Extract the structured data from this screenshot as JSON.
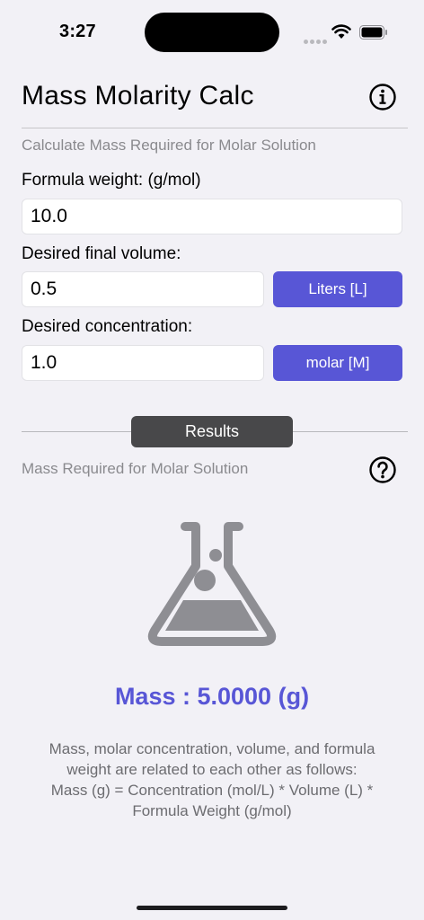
{
  "status_bar": {
    "time": "3:27"
  },
  "header": {
    "title": "Mass Molarity Calc"
  },
  "form": {
    "subtitle": "Calculate Mass Required for Molar Solution",
    "formula_weight_label": "Formula weight:  (g/mol)",
    "formula_weight_value": "10.0",
    "volume_label": "Desired final volume:",
    "volume_value": "0.5",
    "volume_unit": "Liters [L]",
    "concentration_label": "Desired concentration:",
    "concentration_value": "1.0",
    "concentration_unit": "molar [M]"
  },
  "results": {
    "badge": "Results",
    "subtitle": "Mass Required for Molar Solution",
    "mass_label": "Mass : ",
    "mass_value": "5.0000",
    "mass_unit": " (g)",
    "explanation": [
      "Mass, molar concentration, volume, and formula",
      "weight are related to each other as follows:",
      "Mass (g) = Concentration (mol/L) * Volume (L) *",
      "Formula Weight (g/mol)"
    ]
  },
  "colors": {
    "accent": "#5856d6",
    "background": "#f2f1f6",
    "secondary_text": "#8a8a8e"
  }
}
